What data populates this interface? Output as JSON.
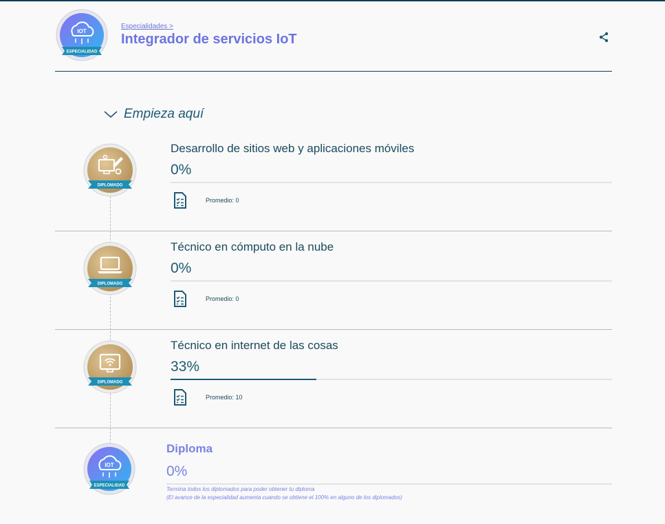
{
  "colors": {
    "primary_dark": "#1d5a73",
    "accent_violet": "#6c74e0",
    "gold_badge": "#c9a872",
    "ribbon_blue": "#1e8fb5"
  },
  "header": {
    "badge_title": "IOT",
    "badge_ribbon": "ESPECIALIDAD",
    "breadcrumb": "Especialidades >",
    "title": "Integrador de servicios IoT",
    "share_icon": "share-icon"
  },
  "start_section": {
    "label": "Empieza aquí",
    "icon": "chevron-down-icon"
  },
  "diplomados": [
    {
      "title": "Desarrollo de sitios web y aplicaciones móviles",
      "progress_text": "0%",
      "progress": 0,
      "average_label": "Promedio: 0",
      "badge_ribbon": "DIPLOMADO",
      "icon": "web-dev-icon"
    },
    {
      "title": "Técnico en cómputo en la nube",
      "progress_text": "0%",
      "progress": 0,
      "average_label": "Promedio: 0",
      "badge_ribbon": "DIPLOMADO",
      "icon": "laptop-icon"
    },
    {
      "title": "Técnico en internet de las cosas",
      "progress_text": "33%",
      "progress": 0.33,
      "average_label": "Promedio: 10",
      "badge_ribbon": "DIPLOMADO",
      "icon": "wifi-monitor-icon"
    }
  ],
  "diploma": {
    "title": "Diploma",
    "progress_text": "0%",
    "note_1": "Termina todos los diplomados para poder obtener tu diploma",
    "note_2": "(El avance de la especialidad aumenta cuando se obtiene el 100% en alguno de los diplomados)",
    "badge_title": "IOT",
    "badge_ribbon": "ESPECIALIDAD"
  }
}
